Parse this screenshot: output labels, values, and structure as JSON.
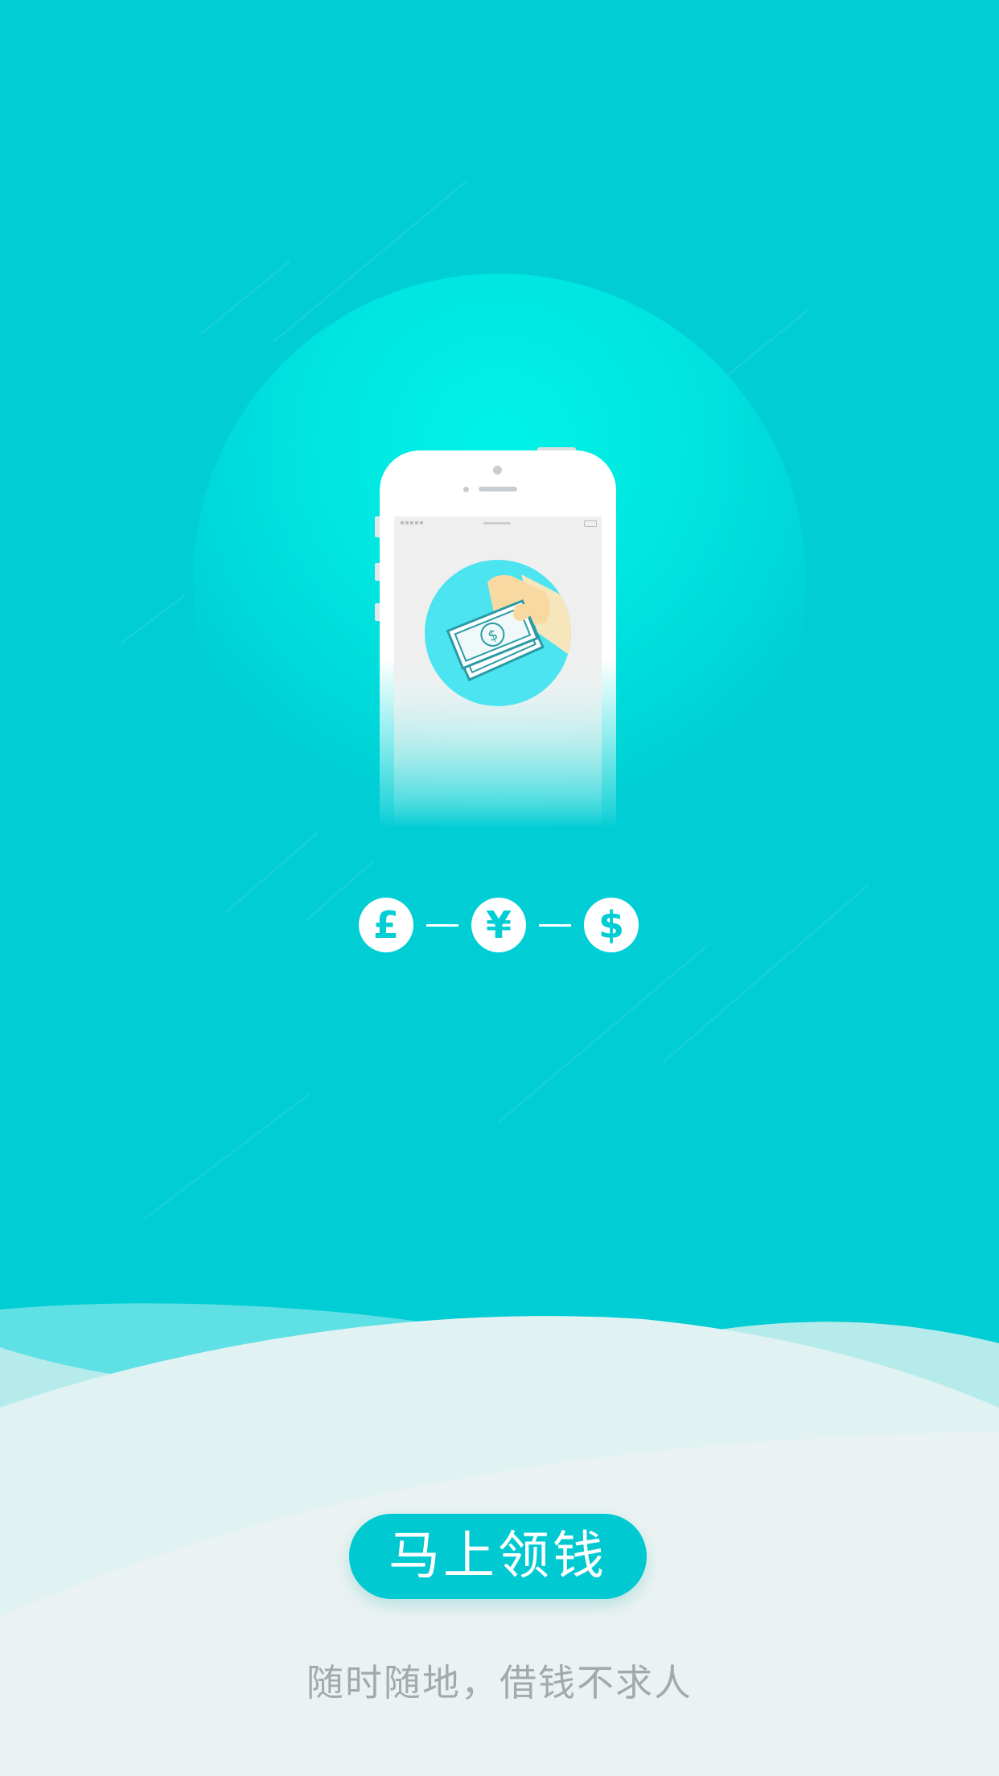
{
  "colors": {
    "background": "#00CDD4",
    "glow": "#00F3E7",
    "wave_bottom": "#EBF3F2",
    "button": "#00C9D1",
    "tagline": "#A4A9AC"
  },
  "illustration": {
    "phone_icon": "smartphone-icon",
    "screen_icon": "hand-holding-cash-icon",
    "cash_symbol": "$"
  },
  "currencies": [
    {
      "symbol": "£",
      "icon": "pound-icon"
    },
    {
      "symbol": "¥",
      "icon": "yen-icon"
    },
    {
      "symbol": "$",
      "icon": "dollar-icon"
    }
  ],
  "cta": {
    "label": "马上领钱"
  },
  "tagline": "随时随地，借钱不求人"
}
